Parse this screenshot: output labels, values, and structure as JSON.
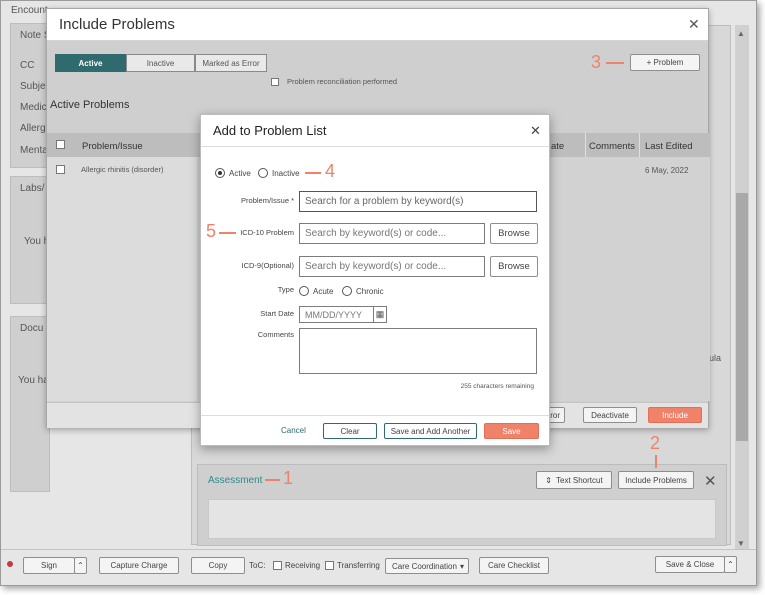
{
  "background_app": {
    "encounter_label": "Encount",
    "note_label": "Note S",
    "sections": [
      "CC",
      "Subje",
      "Medic",
      "Allerg",
      "Menta"
    ],
    "labs_label": "Labs/",
    "labs_text": "You h",
    "docs_label": "Docu",
    "docs_text": "You ha",
    "side_text": "ula",
    "assessment_label": "Assessment",
    "text_shortcut_label": "Text Shortcut",
    "include_problems_label": "Include Problems"
  },
  "bottom_bar": {
    "sign": "Sign",
    "capture_charge": "Capture Charge",
    "copy": "Copy",
    "toc_label": "ToC:",
    "receiving": "Receiving",
    "transferring": "Transferring",
    "care_coordination": "Care Coordination",
    "care_checklist": "Care Checklist",
    "save_close": "Save & Close"
  },
  "include_problems": {
    "title": "Include Problems",
    "tabs": [
      "Active",
      "Inactive",
      "Marked as Error"
    ],
    "selected_tab": "Active",
    "add_problem": "+ Problem",
    "reconciliation": "Problem reconciliation performed",
    "section_title": "Active Problems",
    "columns": [
      "Problem/Issue",
      "ate",
      "Comments",
      "Last Edited"
    ],
    "rows": [
      {
        "problem": "Allergic rhinitis (disorder)",
        "last_edited": "6 May, 2022"
      }
    ],
    "footer": {
      "error": "rror",
      "deactivate": "Deactivate",
      "include": "Include"
    }
  },
  "add_dialog": {
    "title": "Add to Problem List",
    "status_active": "Active",
    "status_inactive": "Inactive",
    "problem_label": "Problem/Issue *",
    "problem_placeholder": "Search for a problem by keyword(s)",
    "icd10_label": "ICD-10 Problem",
    "icd10_placeholder": "Search by keyword(s) or code...",
    "icd9_label": "ICD-9(Optional)",
    "icd9_placeholder": "Search by keyword(s) or code...",
    "browse": "Browse",
    "type_label": "Type",
    "type_acute": "Acute",
    "type_chronic": "Chronic",
    "start_date_label": "Start Date",
    "start_date_placeholder": "MM/DD/YYYY",
    "comments_label": "Comments",
    "chars_remaining": "255 characters remaining",
    "cancel": "Cancel",
    "clear": "Clear",
    "save_add_another": "Save and Add Another",
    "save": "Save"
  },
  "callouts": [
    "1",
    "2",
    "3",
    "4",
    "5"
  ],
  "colors": {
    "accent": "#2f6a6e",
    "save": "#f0826a",
    "callout": "#f0826a"
  }
}
